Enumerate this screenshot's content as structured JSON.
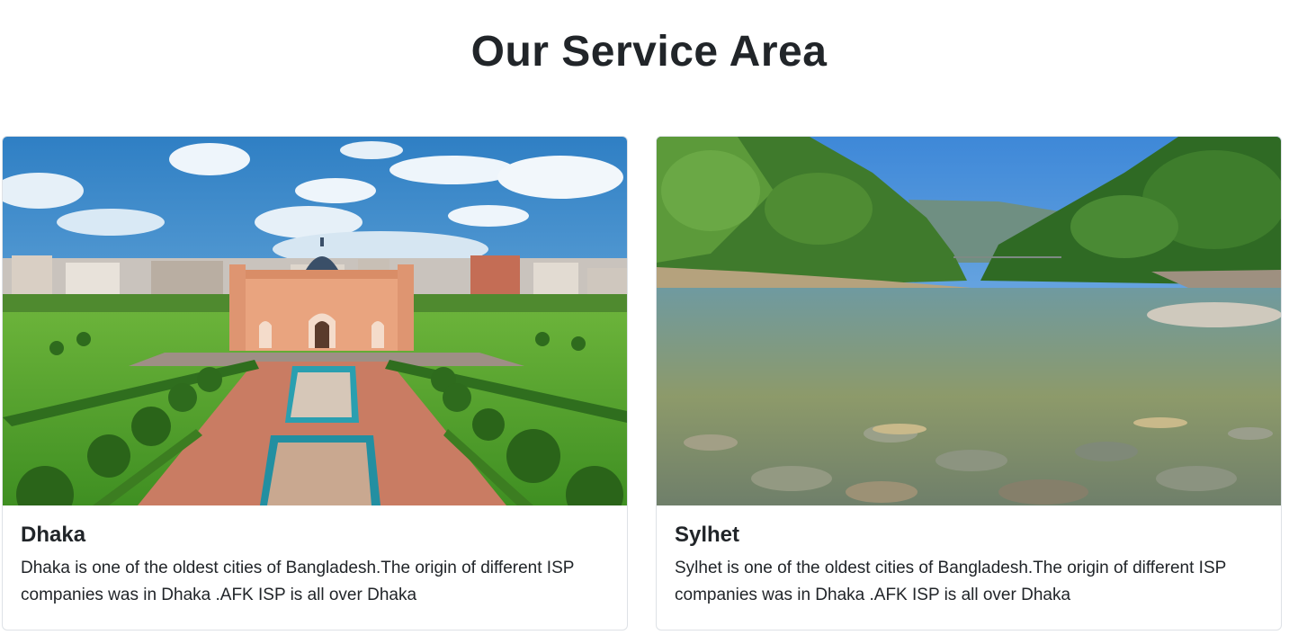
{
  "section": {
    "title": "Our Service Area"
  },
  "cards": [
    {
      "title": "Dhaka",
      "text": "Dhaka is one of the oldest cities of Bangladesh.The origin of different ISP companies was in Dhaka .AFK ISP is all over Dhaka",
      "image": "lalbagh-fort-photo"
    },
    {
      "title": "Sylhet",
      "text": "Sylhet is one of the oldest cities of Bangladesh.The origin of different ISP companies was in Dhaka .AFK ISP is all over Dhaka",
      "image": "river-valley-photo"
    }
  ]
}
